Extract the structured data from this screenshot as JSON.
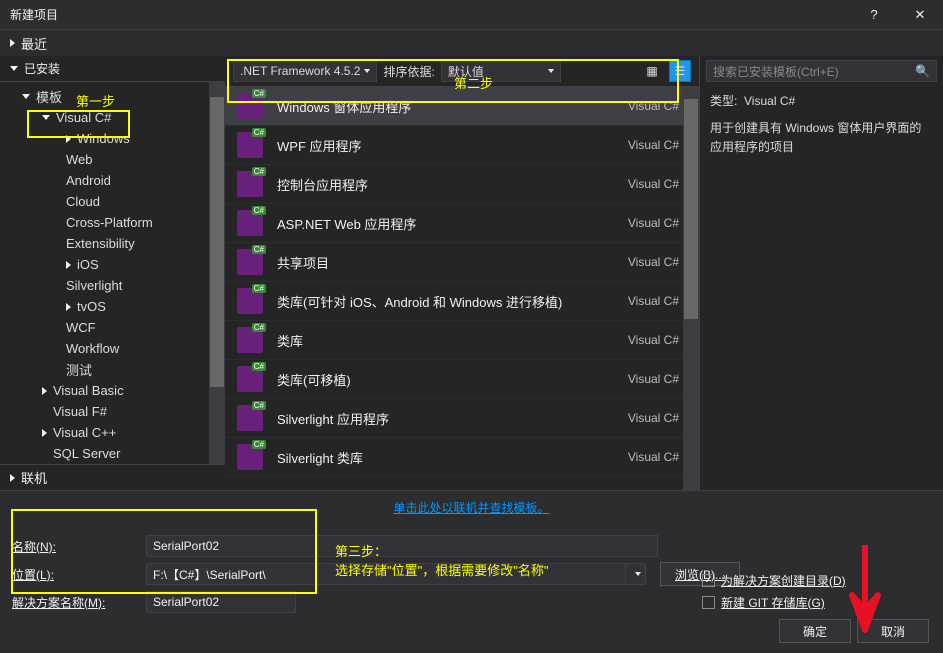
{
  "window": {
    "title": "新建项目"
  },
  "nav": {
    "recent": "最近",
    "installed": "已安装",
    "online": "联机"
  },
  "tree": {
    "templates": "模板",
    "vcsharp": "Visual C#",
    "items": [
      "Windows",
      "Web",
      "Android",
      "Cloud",
      "Cross-Platform",
      "Extensibility",
      "iOS",
      "Silverlight",
      "tvOS",
      "WCF",
      "Workflow",
      "测试"
    ],
    "vb": "Visual Basic",
    "fsharp": "Visual F#",
    "vcpp": "Visual C++",
    "sql": "SQL Server"
  },
  "toolbar": {
    "framework": ".NET Framework 4.5.2",
    "sort_label": "排序依据:",
    "sort_value": "默认值"
  },
  "search": {
    "placeholder": "搜索已安装模板(Ctrl+E)"
  },
  "templates": [
    {
      "name": "Windows 窗体应用程序",
      "lang": "Visual C#",
      "selected": true
    },
    {
      "name": "WPF 应用程序",
      "lang": "Visual C#"
    },
    {
      "name": "控制台应用程序",
      "lang": "Visual C#"
    },
    {
      "name": "ASP.NET Web 应用程序",
      "lang": "Visual C#"
    },
    {
      "name": "共享项目",
      "lang": "Visual C#"
    },
    {
      "name": "类库(可针对 iOS、Android 和 Windows 进行移植)",
      "lang": "Visual C#"
    },
    {
      "name": "类库",
      "lang": "Visual C#"
    },
    {
      "name": "类库(可移植)",
      "lang": "Visual C#"
    },
    {
      "name": "Silverlight 应用程序",
      "lang": "Visual C#"
    },
    {
      "name": "Silverlight 类库",
      "lang": "Visual C#"
    }
  ],
  "desc": {
    "type_label": "类型:",
    "type_value": "Visual C#",
    "text": "用于创建具有 Windows 窗体用户界面的应用程序的项目"
  },
  "link": "单击此处以联机并查找模板。",
  "form": {
    "name_label": "名称(N):",
    "name_value": "SerialPort02",
    "location_label": "位置(L):",
    "location_value": "F:\\【C#】\\SerialPort\\",
    "solution_label": "解决方案名称(M):",
    "solution_value": "SerialPort02",
    "browse": "浏览(B)...",
    "create_dir": "为解决方案创建目录(D)",
    "git": "新建 GIT 存储库(G)"
  },
  "buttons": {
    "ok": "确定",
    "cancel": "取消"
  },
  "annotations": {
    "step1": "第一步",
    "step2": "第二步",
    "step3a": "第三步：",
    "step3b": "选择存储\"位置\"，根据需要修改\"名称\""
  }
}
